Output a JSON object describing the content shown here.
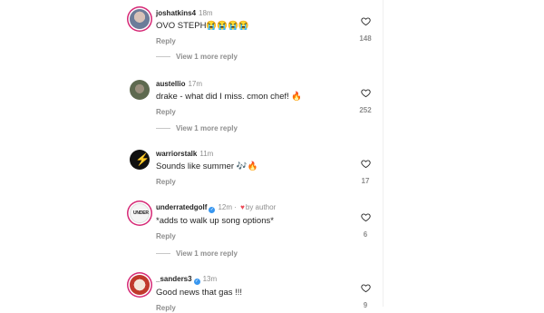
{
  "comments": [
    {
      "username": "joshatkins4",
      "time": "18m",
      "text": "OVO STEPH😭😭😭😭",
      "reply": "Reply",
      "likes": "148",
      "view_more": "View 1 more reply"
    },
    {
      "username": "austellio",
      "time": "17m",
      "text": "drake - what did I miss. cmon chef! 🔥",
      "reply": "Reply",
      "likes": "252",
      "view_more": "View 1 more reply"
    },
    {
      "username": "warriorstalk",
      "time": "11m",
      "text": "Sounds like summer 🎶🔥",
      "reply": "Reply",
      "likes": "17"
    },
    {
      "username": "underratedgolf",
      "time": "12m",
      "author_tag": "by author",
      "text": "*adds to walk up song options*",
      "reply": "Reply",
      "likes": "6",
      "view_more": "View 1 more reply"
    },
    {
      "username": "_sanders3",
      "time": "13m",
      "text": "Good news that gas !!!",
      "reply": "Reply",
      "likes": "9"
    }
  ],
  "icons": {
    "like": "heart-outline-icon",
    "verified": "verified-badge-icon",
    "liked_by_author": "heart-filled-icon"
  },
  "colors": {
    "muted": "#8e8e8e",
    "story_ring": "#d62976",
    "verified": "#3897f0",
    "author_heart": "#ed4956"
  }
}
